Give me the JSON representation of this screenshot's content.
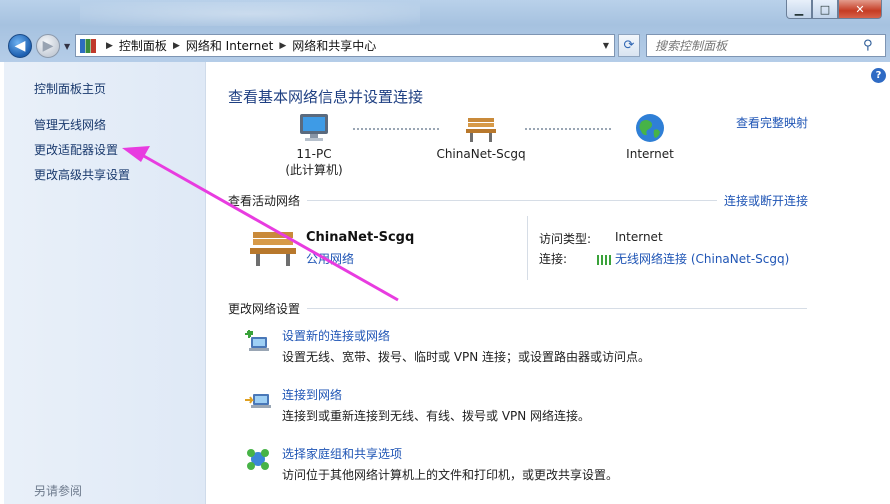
{
  "window": {
    "minimize_glyph": "▁",
    "maximize_glyph": "□",
    "close_glyph": "✕"
  },
  "nav": {
    "back_glyph": "◀",
    "forward_glyph": "▶",
    "dropdown_glyph": "▼",
    "refresh_glyph": "⟳"
  },
  "breadcrumb": {
    "items": [
      "控制面板",
      "网络和 Internet",
      "网络和共享中心"
    ]
  },
  "search": {
    "placeholder": "搜索控制面板"
  },
  "sidebar": {
    "items": [
      {
        "label": "控制面板主页"
      },
      {
        "label": "管理无线网络"
      },
      {
        "label": "更改适配器设置"
      },
      {
        "label": "更改高级共享设置"
      }
    ],
    "see_also": "另请参阅"
  },
  "main": {
    "title": "查看基本网络信息并设置连接",
    "full_map_link": "查看完整映射",
    "help_glyph": "?",
    "map": {
      "pc_name": "11-PC",
      "pc_sub": "(此计算机)",
      "network_name": "ChinaNet-Scgq",
      "internet_label": "Internet"
    },
    "active_networks": {
      "heading": "查看活动网络",
      "connect_link": "连接或断开连接",
      "network_name": "ChinaNet-Scgq",
      "network_type": "公用网络",
      "access_type_label": "访问类型:",
      "access_type_value": "Internet",
      "connection_label": "连接:",
      "connection_value": "无线网络连接 (ChinaNet-Scgq)"
    },
    "change_settings": {
      "heading": "更改网络设置",
      "tasks": [
        {
          "title": "设置新的连接或网络",
          "desc": "设置无线、宽带、拨号、临时或 VPN 连接；或设置路由器或访问点。",
          "icon": "new-connection-icon"
        },
        {
          "title": "连接到网络",
          "desc": "连接到或重新连接到无线、有线、拨号或 VPN 网络连接。",
          "icon": "connect-network-icon"
        },
        {
          "title": "选择家庭组和共享选项",
          "desc": "访问位于其他网络计算机上的文件和打印机，或更改共享设置。",
          "icon": "homegroup-icon"
        }
      ]
    }
  },
  "colors": {
    "link": "#1f55b5",
    "title": "#1e3f82",
    "annotation_arrow": "#e83ce0"
  }
}
